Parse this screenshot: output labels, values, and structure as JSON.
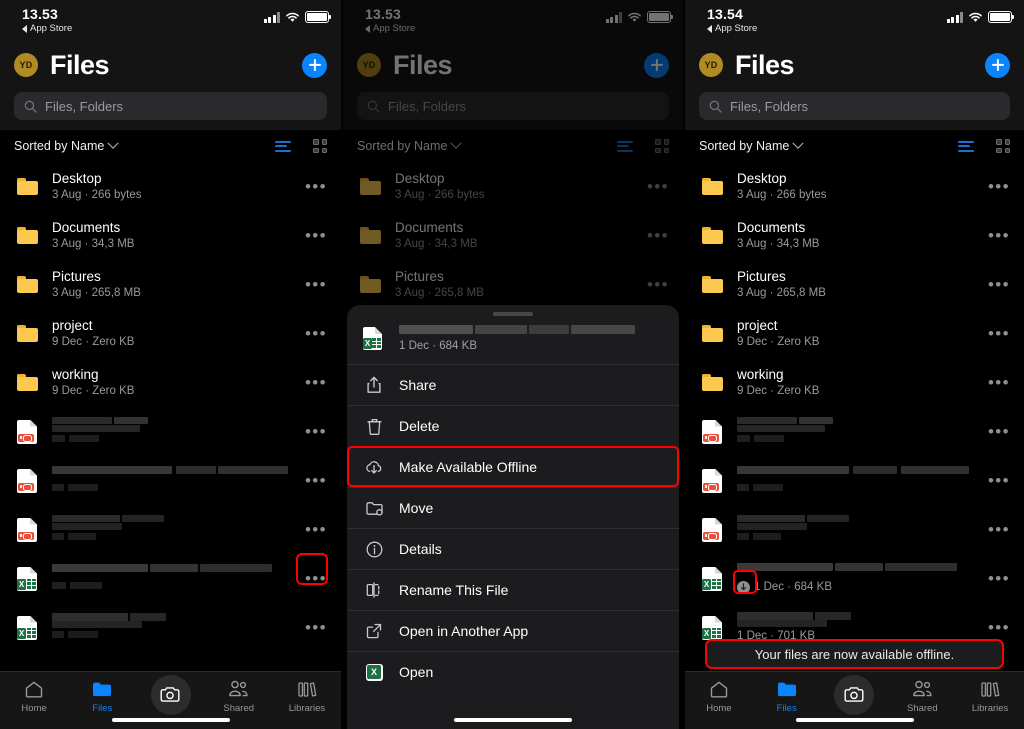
{
  "app": {
    "title": "Files",
    "avatar_initials": "YD",
    "accent_blue": "#0b84ff",
    "avatar_color": "#b08a22",
    "highlight_color": "#ff0000"
  },
  "panels": [
    {
      "id": "panel-1",
      "status": {
        "time": "13.53",
        "back_label": "App Store"
      },
      "search_placeholder": "Files, Folders",
      "sort_label": "Sorted by Name"
    },
    {
      "id": "panel-2",
      "status": {
        "time": "13.53",
        "back_label": "App Store"
      },
      "search_placeholder": "Files, Folders",
      "sort_label": "Sorted by Name"
    },
    {
      "id": "panel-3",
      "status": {
        "time": "13.54",
        "back_label": "App Store"
      },
      "search_placeholder": "Files, Folders",
      "sort_label": "Sorted by Name"
    }
  ],
  "folders": [
    {
      "name": "Desktop",
      "meta": "3 Aug · 266 bytes"
    },
    {
      "name": "Documents",
      "meta": "3 Aug · 34,3 MB"
    },
    {
      "name": "Pictures",
      "meta": "3 Aug · 265,8 MB"
    },
    {
      "name": "project",
      "meta": "9 Dec · Zero KB"
    },
    {
      "name": "working",
      "meta": "9 Dec · Zero KB"
    }
  ],
  "files": [
    {
      "type": "pdf",
      "name_redacted": true,
      "meta_redacted": true
    },
    {
      "type": "pdf",
      "name_redacted": true,
      "meta_redacted": true
    },
    {
      "type": "pdf",
      "name_redacted": true,
      "meta_redacted": true
    },
    {
      "type": "excel",
      "name_redacted": true,
      "meta_redacted": true
    },
    {
      "type": "excel",
      "name_redacted": true,
      "meta_redacted": true
    }
  ],
  "files_panel3": [
    {
      "type": "excel",
      "meta": "1 Dec · 684 KB",
      "offline": true
    },
    {
      "type": "excel",
      "meta": "1 Dec · 701 KB",
      "offline": false
    }
  ],
  "action_sheet": {
    "file_meta": "1 Dec · 684 KB",
    "file_type": "excel",
    "items": [
      {
        "label": "Share",
        "icon": "share-icon",
        "highlighted": false
      },
      {
        "label": "Delete",
        "icon": "trash-icon",
        "highlighted": false
      },
      {
        "label": "Make Available Offline",
        "icon": "cloud-download-icon",
        "highlighted": true
      },
      {
        "label": "Move",
        "icon": "folder-move-icon",
        "highlighted": false
      },
      {
        "label": "Details",
        "icon": "info-icon",
        "highlighted": false
      },
      {
        "label": "Rename This File",
        "icon": "rename-icon",
        "highlighted": false
      },
      {
        "label": "Open in Another App",
        "icon": "external-link-icon",
        "highlighted": false
      },
      {
        "label": "Open",
        "icon": "excel-icon",
        "highlighted": false
      }
    ]
  },
  "toast": {
    "message": "Your files are now available offline."
  },
  "tabbar": {
    "items": [
      {
        "label": "Home",
        "icon": "home-icon",
        "active": false
      },
      {
        "label": "Files",
        "icon": "folder-icon",
        "active": true
      },
      {
        "label": "Shared",
        "icon": "people-icon",
        "active": false
      },
      {
        "label": "Libraries",
        "icon": "libraries-icon",
        "active": false
      }
    ],
    "camera_icon": "camera-icon"
  }
}
